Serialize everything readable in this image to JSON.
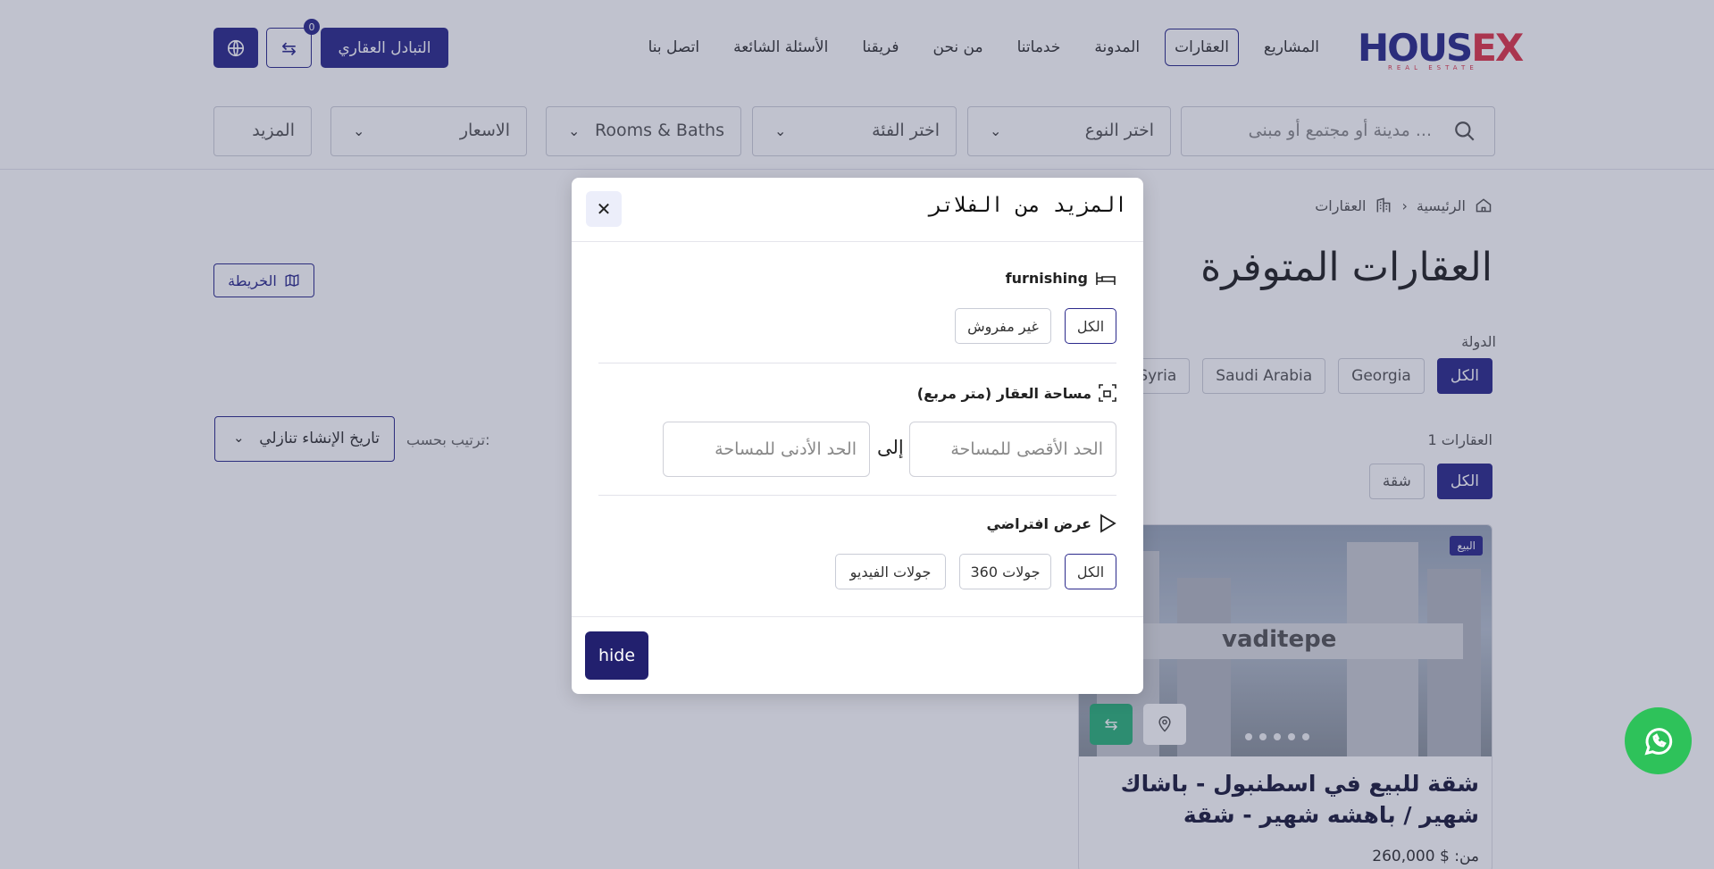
{
  "header": {
    "logo_main": "HOUS",
    "logo_x": "EX",
    "logo_sub": "REAL ESTATE",
    "nav": [
      "المشاريع",
      "العقارات",
      "المدونة",
      "خدماتنا",
      "من نحن",
      "فريقنا",
      "الأسئلة الشائعة",
      "اتصل بنا"
    ],
    "active_nav": "العقارات",
    "exchange_label": "التبادل العقاري",
    "compare_count": "0"
  },
  "filters": {
    "search_placeholder": "مدينة أو مجتمع أو مبنى ...",
    "type": "اختر النوع",
    "category": "اختر الفئة",
    "rooms": "Rooms & Baths",
    "price": "الاسعار",
    "more": "المزيد"
  },
  "main": {
    "breadcrumb_home": "الرئيسية",
    "breadcrumb_current": "العقارات",
    "title": "العقارات المتوفرة",
    "map_label": "الخريطة",
    "country_label": "الدولة",
    "countries": [
      "الكل",
      "Georgia",
      "Saudi Arabia",
      "Syria"
    ],
    "count_label": "1 العقارات",
    "types": [
      "الكل",
      "شقة"
    ],
    "sort_label": "ترتيب بحسب:",
    "sort_value": "تاريخ الإنشاء تنازلي"
  },
  "card": {
    "badge": "البيع",
    "image_text": "vaditepe",
    "title": "شقة للبيع في اسطنبول - باشاك شهير / باهشه شهير - شقة",
    "price_prefix": "من:",
    "price": "$ 260,000"
  },
  "modal": {
    "title": "المزيد من الفلاتر",
    "furnishing_title": "furnishing",
    "furnishing_options": [
      "الكل",
      "غير مفروش"
    ],
    "area_title": "مساحة العقار (متر مربع)",
    "area_max_placeholder": "الحد الأقصى للمساحة",
    "area_min_placeholder": "الحد الأدنى للمساحة",
    "to_label": "إلى",
    "virtual_title": "عرض افتراضي",
    "virtual_options": [
      "الكل",
      "جولات 360",
      "جولات الفيديو"
    ],
    "hide_label": "hide"
  },
  "colors": {
    "brand": "#2c2a8c",
    "whatsapp": "#2ec25a",
    "hide_button": "#22206e"
  }
}
